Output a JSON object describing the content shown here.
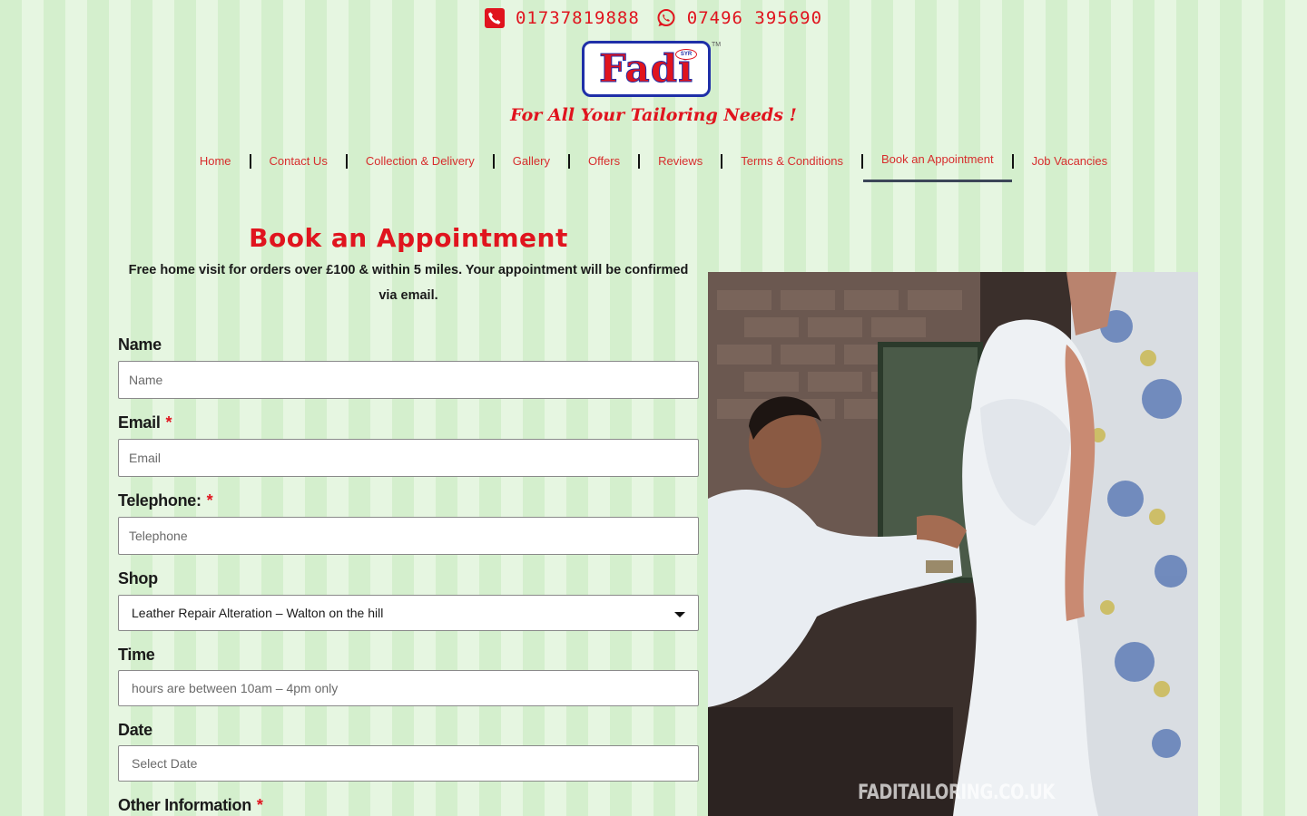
{
  "header": {
    "phone_landline": "01737819888",
    "phone_mobile": "07496 395690",
    "logo_text": "Fadi",
    "logo_badge": "SYR",
    "logo_tm": "TM",
    "tagline": "For All Your Tailoring Needs !"
  },
  "nav": {
    "items": [
      {
        "label": "Home"
      },
      {
        "label": "Contact Us"
      },
      {
        "label": "Collection & Delivery"
      },
      {
        "label": "Gallery"
      },
      {
        "label": "Offers"
      },
      {
        "label": "Reviews"
      },
      {
        "label": "Terms & Conditions"
      },
      {
        "label": "Book an Appointment",
        "active": true
      },
      {
        "label": "Job Vacancies"
      }
    ]
  },
  "form": {
    "heading": "Book an Appointment",
    "intro": "Free home visit for orders over £100 & within 5 miles. Your appointment will be confirmed via email.",
    "name_label": "Name",
    "name_placeholder": "Name",
    "email_label": "Email",
    "email_placeholder": "Email",
    "telephone_label": "Telephone:",
    "telephone_placeholder": "Telephone",
    "shop_label": "Shop",
    "shop_selected": "Leather Repair Alteration – Walton on the hill",
    "time_label": "Time",
    "time_placeholder": "hours are between 10am – 4pm only",
    "date_label": "Date",
    "date_placeholder": "Select Date",
    "other_label": "Other Information",
    "required_mark": "*"
  },
  "photo": {
    "watermark": "FADITAILORING.CO.UK"
  },
  "colors": {
    "brand_red": "#e0141e",
    "brand_blue": "#1f2fa8",
    "stripe_dark": "#d4efcd",
    "stripe_light": "#e6f6e1"
  }
}
